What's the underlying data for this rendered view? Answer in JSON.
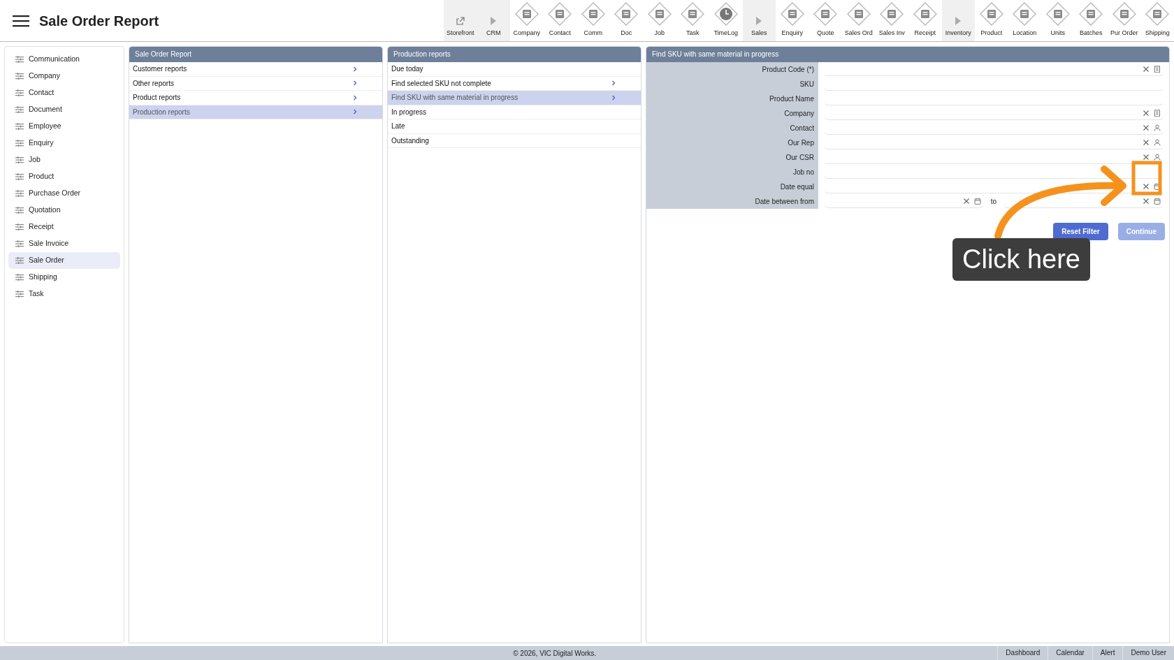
{
  "header": {
    "title": "Sale Order Report"
  },
  "toolbar": [
    {
      "label": "Storefront",
      "kind": "link"
    },
    {
      "label": "CRM",
      "kind": "section"
    },
    {
      "label": "Company",
      "kind": "module"
    },
    {
      "label": "Contact",
      "kind": "module"
    },
    {
      "label": "Comm",
      "kind": "module"
    },
    {
      "label": "Doc",
      "kind": "module"
    },
    {
      "label": "Job",
      "kind": "module"
    },
    {
      "label": "Task",
      "kind": "module"
    },
    {
      "label": "TimeLog",
      "kind": "clock"
    },
    {
      "label": "Sales",
      "kind": "section"
    },
    {
      "label": "Enquiry",
      "kind": "module"
    },
    {
      "label": "Quote",
      "kind": "module"
    },
    {
      "label": "Sales Ord",
      "kind": "module"
    },
    {
      "label": "Sales Inv",
      "kind": "module"
    },
    {
      "label": "Receipt",
      "kind": "module"
    },
    {
      "label": "Inventory",
      "kind": "section"
    },
    {
      "label": "Product",
      "kind": "module"
    },
    {
      "label": "Location",
      "kind": "module"
    },
    {
      "label": "Units",
      "kind": "module"
    },
    {
      "label": "Batches",
      "kind": "module"
    },
    {
      "label": "Pur Order",
      "kind": "module"
    },
    {
      "label": "Shipping",
      "kind": "module"
    }
  ],
  "sidebar": {
    "items": [
      {
        "label": "Communication",
        "selected": false
      },
      {
        "label": "Company",
        "selected": false
      },
      {
        "label": "Contact",
        "selected": false
      },
      {
        "label": "Document",
        "selected": false
      },
      {
        "label": "Employee",
        "selected": false
      },
      {
        "label": "Enquiry",
        "selected": false
      },
      {
        "label": "Job",
        "selected": false
      },
      {
        "label": "Product",
        "selected": false
      },
      {
        "label": "Purchase Order",
        "selected": false
      },
      {
        "label": "Quotation",
        "selected": false
      },
      {
        "label": "Receipt",
        "selected": false
      },
      {
        "label": "Sale Invoice",
        "selected": false
      },
      {
        "label": "Sale Order",
        "selected": true
      },
      {
        "label": "Shipping",
        "selected": false
      },
      {
        "label": "Task",
        "selected": false
      }
    ]
  },
  "report_panel": {
    "title": "Sale Order Report",
    "items": [
      {
        "label": "Customer reports",
        "selected": false,
        "has_submenu": true
      },
      {
        "label": "Other reports",
        "selected": false,
        "has_submenu": true
      },
      {
        "label": "Product reports",
        "selected": false,
        "has_submenu": true
      },
      {
        "label": "Production reports",
        "selected": true,
        "has_submenu": true
      }
    ]
  },
  "production_panel": {
    "title": "Production reports",
    "items": [
      {
        "label": "Due today",
        "selected": false,
        "has_submenu": false
      },
      {
        "label": "Find selected SKU not complete",
        "selected": false,
        "has_submenu": true
      },
      {
        "label": "Find SKU with same material in progress",
        "selected": true,
        "has_submenu": true
      },
      {
        "label": "In progress",
        "selected": false,
        "has_submenu": false
      },
      {
        "label": "Late",
        "selected": false,
        "has_submenu": false
      },
      {
        "label": "Outstanding",
        "selected": false,
        "has_submenu": false
      }
    ]
  },
  "form_panel": {
    "title": "Find SKU with same material in progress",
    "fields": [
      {
        "label": "Product Code (*)",
        "kind": "company_lookup"
      },
      {
        "label": "SKU",
        "kind": "text"
      },
      {
        "label": "Product Name",
        "kind": "text"
      },
      {
        "label": "Company",
        "kind": "company_lookup"
      },
      {
        "label": "Contact",
        "kind": "person_lookup"
      },
      {
        "label": "Our Rep",
        "kind": "person_lookup"
      },
      {
        "label": "Our CSR",
        "kind": "person_lookup"
      },
      {
        "label": "Job no",
        "kind": "text"
      },
      {
        "label": "Date equal",
        "kind": "date"
      },
      {
        "label": "Date between from",
        "kind": "range",
        "separator": "to"
      }
    ],
    "buttons": [
      {
        "label": "Reset Filter",
        "disabled": false
      },
      {
        "label": "Continue",
        "disabled": true
      }
    ]
  },
  "callout": {
    "text": "Click here"
  },
  "footer": {
    "copyright": "© 2026, VIC Digital Works.",
    "links": [
      "Dashboard",
      "Calendar",
      "Alert",
      "Demo User"
    ]
  }
}
